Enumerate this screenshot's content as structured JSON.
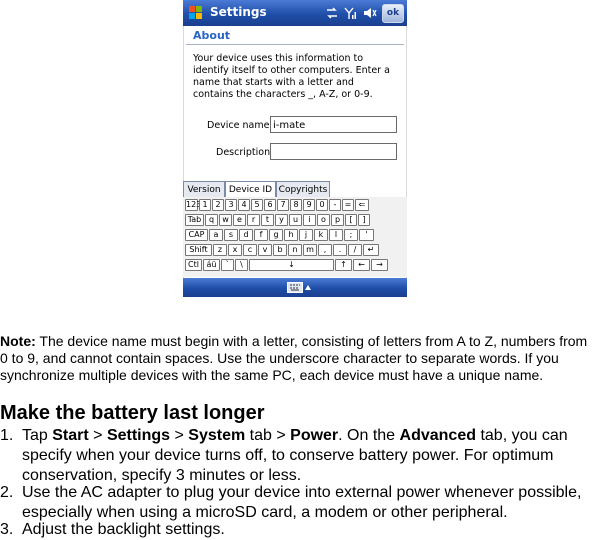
{
  "device": {
    "title": "Settings",
    "ok_label": "ok",
    "section": "About",
    "info_text": "Your device uses this information to identify itself to other computers. Enter a name that starts with a letter and contains the characters _, A-Z, or 0-9.",
    "device_name_label": "Device name:",
    "device_name_value": "i-mate",
    "description_label": "Description:",
    "description_value": "",
    "tabs": [
      "Version",
      "Device ID",
      "Copyrights"
    ],
    "keyboard": {
      "row1": [
        "123",
        "1",
        "2",
        "3",
        "4",
        "5",
        "6",
        "7",
        "8",
        "9",
        "0",
        "-",
        "=",
        "⇐"
      ],
      "row2": [
        "Tab",
        "q",
        "w",
        "e",
        "r",
        "t",
        "y",
        "u",
        "i",
        "o",
        "p",
        "[",
        "]"
      ],
      "row3": [
        "CAP",
        "a",
        "s",
        "d",
        "f",
        "g",
        "h",
        "j",
        "k",
        "l",
        ";",
        "'"
      ],
      "row4": [
        "Shift",
        "z",
        "x",
        "c",
        "v",
        "b",
        "n",
        "m",
        ",",
        ".",
        "/",
        "↵"
      ],
      "row5": [
        "Ctl",
        "áü",
        "`",
        "\\",
        "↓",
        "↑",
        "←",
        "→"
      ]
    },
    "colors": {
      "titlebar": "#1f4ea8",
      "accent": "#2a64c5"
    }
  },
  "note": {
    "label": "Note:",
    "text": " The device name must begin with a letter, consisting of letters from A to Z, numbers from 0 to 9, and cannot contain spaces. Use the underscore character to separate words. If you synchronize multiple devices with the same PC, each device must have a unique name."
  },
  "heading": "Make the battery last longer",
  "steps": {
    "s1": {
      "num": "1.",
      "p1": "Tap ",
      "b1": "Start",
      "p2": " > ",
      "b2": "Settings",
      "p3": " > ",
      "b3": "System",
      "p4": " tab > ",
      "b4": "Power",
      "p5": ". On the ",
      "b5": "Advanced",
      "p6": " tab, you can specify when your device turns off, to conserve battery power. For optimum conservation, specify 3 minutes or less."
    },
    "s2": {
      "num": "2.",
      "text": "Use the AC adapter to plug your device into external power whenever possible, especially when using a microSD card, a modem or other peripheral."
    },
    "s3": {
      "num": "3.",
      "text": "Adjust the backlight settings."
    }
  }
}
